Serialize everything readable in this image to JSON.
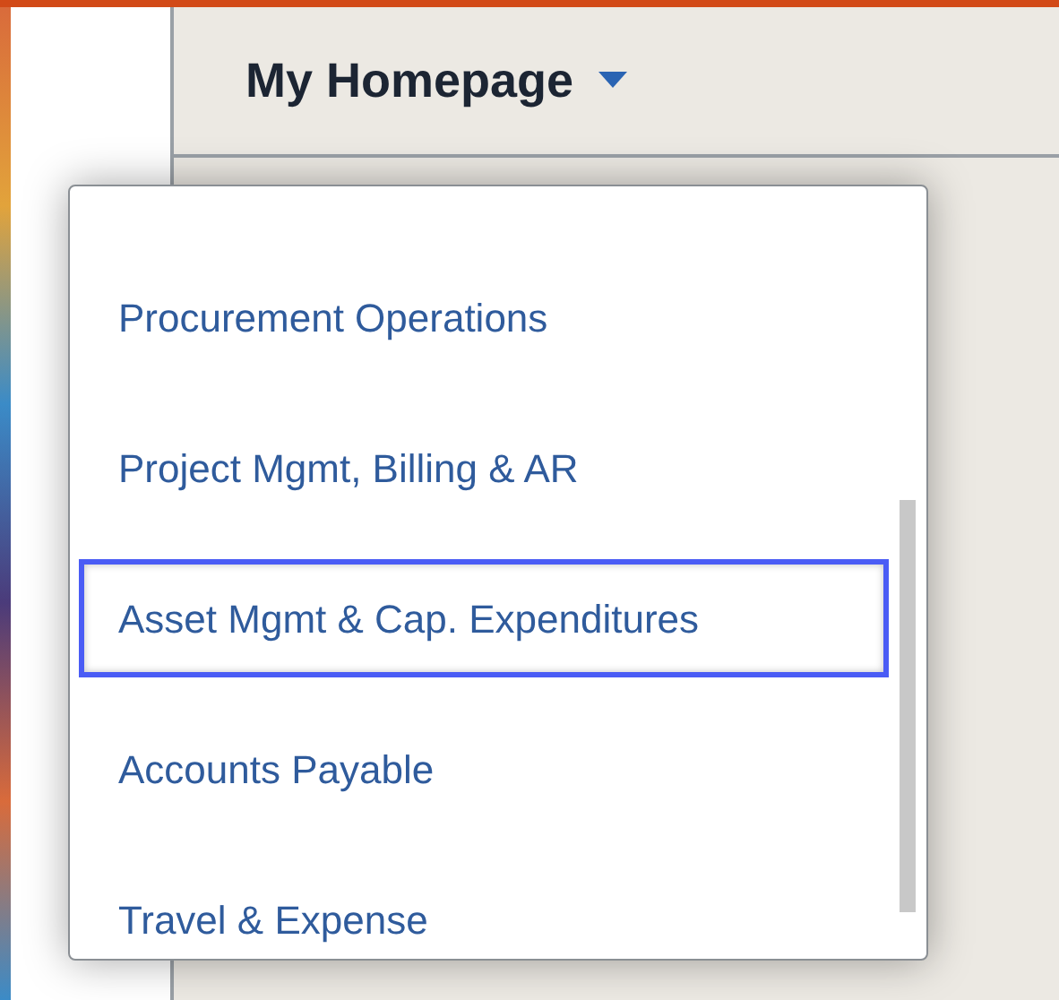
{
  "header": {
    "title": "My Homepage"
  },
  "menu": {
    "items": [
      {
        "label": "Procurement Operations",
        "selected": false
      },
      {
        "label": "Project Mgmt, Billing & AR",
        "selected": false
      },
      {
        "label": "Asset Mgmt & Cap. Expenditures",
        "selected": true
      },
      {
        "label": "Accounts Payable",
        "selected": false
      },
      {
        "label": "Travel & Expense",
        "selected": false
      }
    ]
  }
}
